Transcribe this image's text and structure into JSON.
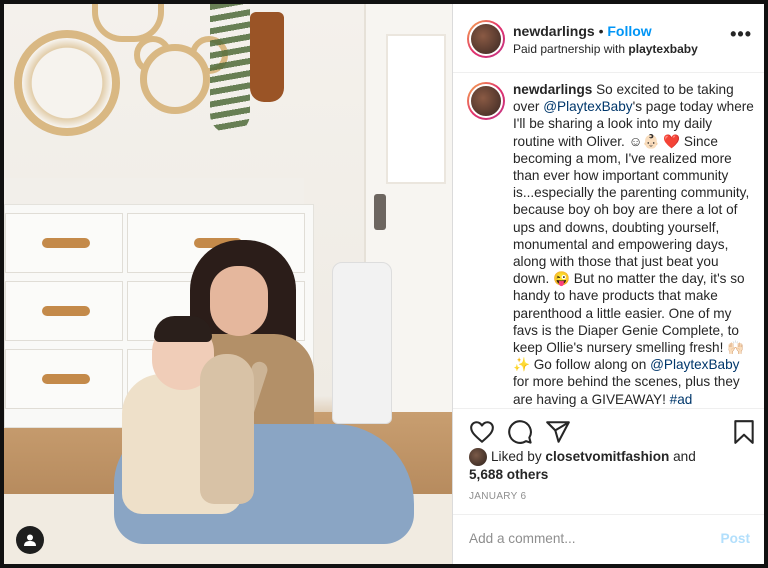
{
  "post": {
    "username": "newdarlings",
    "separator": "•",
    "follow_label": "Follow",
    "partnership_prefix": "Paid partnership with",
    "partner": "playtexbaby",
    "more_label": "•••"
  },
  "caption": {
    "username": "newdarlings",
    "part1": " So excited to be taking over ",
    "mention1": "@PlaytexBaby",
    "part2": "'s page today where I'll be sharing a look into my daily routine with Oliver. ☺👶🏻 ❤️ Since becoming a mom, I've realized more than ever how important community is...especially the parenting community, because boy oh boy are there a lot of ups and downs, doubting yourself, monumental and empowering days, along with those that just beat you down. 😜 But no matter the day, it's so handy to have products that make parenthood a little easier. One of my favs is the Diaper Genie Complete, to keep Ollie's nursery smelling fresh! 🙌🏻 ✨ Go follow along on ",
    "mention2": "@PlaytexBaby",
    "part3": " for more behind the scenes, plus they are having a GIVEAWAY! ",
    "hashtag": "#ad"
  },
  "likes": {
    "prefix": "Liked by",
    "user": "closetvomitfashion",
    "and": "and",
    "count": "5,688 others"
  },
  "date": "JANUARY 6",
  "comment": {
    "placeholder": "Add a comment...",
    "post_label": "Post"
  },
  "icons": {
    "like": "heart-icon",
    "comment": "comment-icon",
    "share": "paper-plane-icon",
    "save": "bookmark-icon",
    "user": "user-icon"
  },
  "colors": {
    "follow": "#0095f6",
    "mention": "#00376b",
    "post_disabled": "#b2dffc"
  }
}
